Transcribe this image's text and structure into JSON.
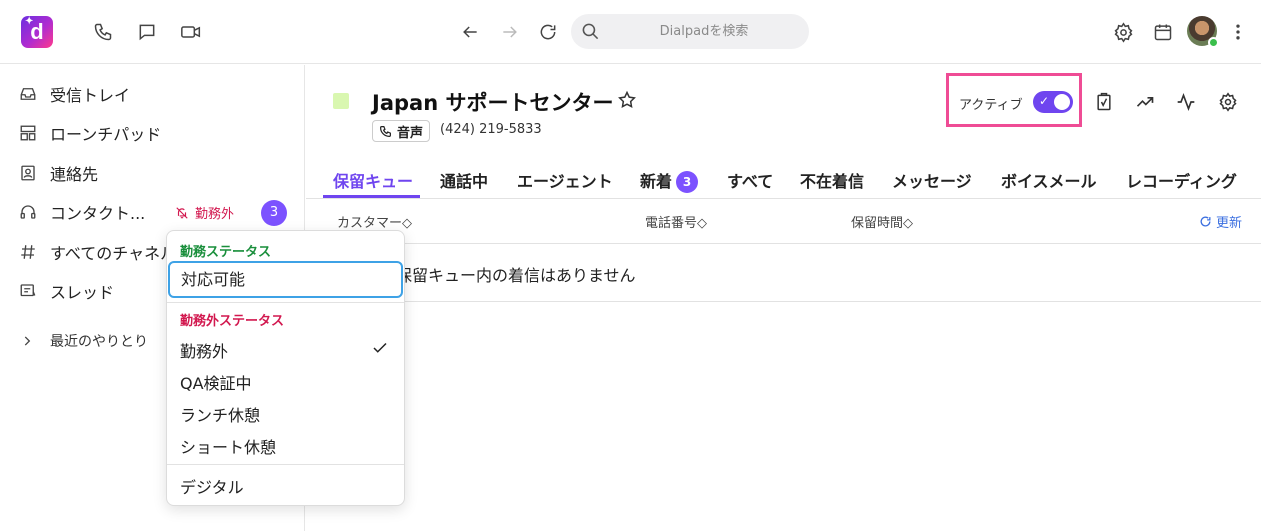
{
  "app": {
    "logo_letter": "d",
    "search_placeholder": "Dialpadを検索",
    "accent": "#7c52ff"
  },
  "top_icons": [
    "phone-icon",
    "chat-icon",
    "video-icon",
    "arrow-left-icon",
    "arrow-right-icon",
    "reload-icon",
    "settings-icon",
    "calendar-icon",
    "more-vertical-icon"
  ],
  "sidebar": {
    "items": [
      {
        "label": "受信トレイ",
        "icon": "inbox-icon"
      },
      {
        "label": "ローンチパッド",
        "icon": "launchpad-icon"
      },
      {
        "label": "連絡先",
        "icon": "contacts-icon"
      },
      {
        "label": "コンタクト...",
        "icon": "headset-icon"
      },
      {
        "label": "すべてのチャネル",
        "icon": "hash-icon"
      },
      {
        "label": "スレッド",
        "icon": "thread-icon"
      }
    ],
    "off_duty_label": "勤務外",
    "contact_count": "3",
    "recent_label": "最近のやりとり"
  },
  "dropdown": {
    "on_duty_header": "勤務ステータス",
    "on_duty_color": "#1a8f3c",
    "selected_option": "対応可能",
    "off_duty_header": "勤務外ステータス",
    "off_duty_color": "#d2184f",
    "off_duty_options": [
      "勤務外",
      "QA検証中",
      "ランチ休憩",
      "ショート休憩"
    ],
    "checked_option": "勤務外",
    "other_option": "デジタル"
  },
  "queue": {
    "title": "Japan サポートセンター",
    "color": "#d9f7b0",
    "channel_label": "音声",
    "phone": "(424) 219-5833",
    "active_label": "アクティブ",
    "active": true
  },
  "tabs": [
    {
      "label": "保留キュー",
      "active": true
    },
    {
      "label": "通話中"
    },
    {
      "label": "エージェント"
    },
    {
      "label": "新着",
      "badge": "3"
    },
    {
      "label": "すべて"
    },
    {
      "label": "不在着信"
    },
    {
      "label": "メッセージ"
    },
    {
      "label": "ボイスメール"
    },
    {
      "label": "レコーディング"
    }
  ],
  "table": {
    "columns": [
      "カスタマー",
      "電話番号",
      "保留時間"
    ],
    "refresh_label": "更新",
    "empty_message": "保留キュー内の着信はありません"
  }
}
